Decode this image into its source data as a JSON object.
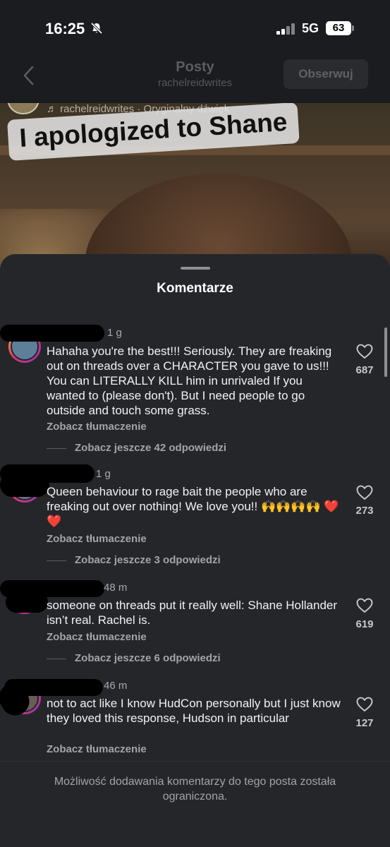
{
  "status": {
    "time": "16:25",
    "network": "5G",
    "battery": "63"
  },
  "header": {
    "title": "Posty",
    "subtitle": "rachelreidwrites",
    "follow_label": "Obserwuj"
  },
  "video": {
    "audio_meta": "♬ rachelreidwrites · Oryginalny dźwięk",
    "caption": "I apologized to Shane"
  },
  "sheet": {
    "title": "Komentarze"
  },
  "comments": [
    {
      "time": "1 g",
      "text": "Hahaha you're the best!!! Seriously. They are freaking out on threads over a CHARACTER you gave to us!!! You can LITERALLY KILL him in unrivaled If you wanted to (please don't). But I need people to go outside and touch some grass.",
      "translate": "Zobacz tłumaczenie",
      "replies": "Zobacz jeszcze 42 odpowiedzi",
      "likes": "687"
    },
    {
      "time": "1 g",
      "text": "Queen behaviour to rage bait the people who are freaking out over nothing! We love you!! 🙌🙌🙌🙌 ❤️❤️",
      "translate": "Zobacz tłumaczenie",
      "replies": "Zobacz jeszcze 3 odpowiedzi",
      "likes": "273"
    },
    {
      "time": "48 m",
      "text": "someone on threads put it really well: Shane Hollander isn’t real. Rachel is.",
      "translate": "Zobacz tłumaczenie",
      "replies": "Zobacz jeszcze 6 odpowiedzi",
      "likes": "619"
    },
    {
      "time": "46 m",
      "text": "not to act like I know HudCon personally but I just know they loved this response, Hudson in particular",
      "translate": "Zobacz tłumaczenie",
      "likes": "127"
    }
  ],
  "footer": {
    "notice": "Możliwość dodawania komentarzy do tego posta została ograniczona."
  }
}
